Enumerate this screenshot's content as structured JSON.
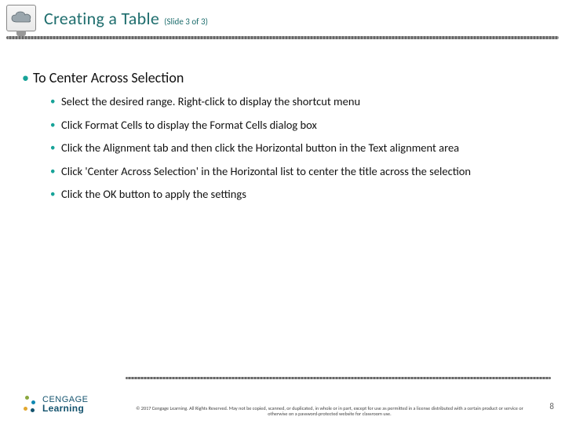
{
  "header": {
    "title": "Creating a Table",
    "subtitle": "(Slide 3 of 3)"
  },
  "content": {
    "heading": "To Center Across Selection",
    "steps": [
      "Select the desired range. Right-click to display the shortcut menu",
      "Click Format Cells to display the Format Cells dialog box",
      "Click the Alignment tab and then click the Horizontal button in the Text alignment area",
      "Click 'Center Across Selection' in the Horizontal list to center the title across the selection",
      "Click the OK button to apply the settings"
    ]
  },
  "footer": {
    "logoLine1": "CENGAGE",
    "logoLine2": "Learning",
    "copyright": "© 2017 Cengage Learning. All Rights Reserved. May not be copied, scanned, or duplicated, in whole or in part, except for use as permitted in a license distributed with a certain product or service or otherwise on a password-protected website for classroom use.",
    "pageNumber": "8"
  }
}
